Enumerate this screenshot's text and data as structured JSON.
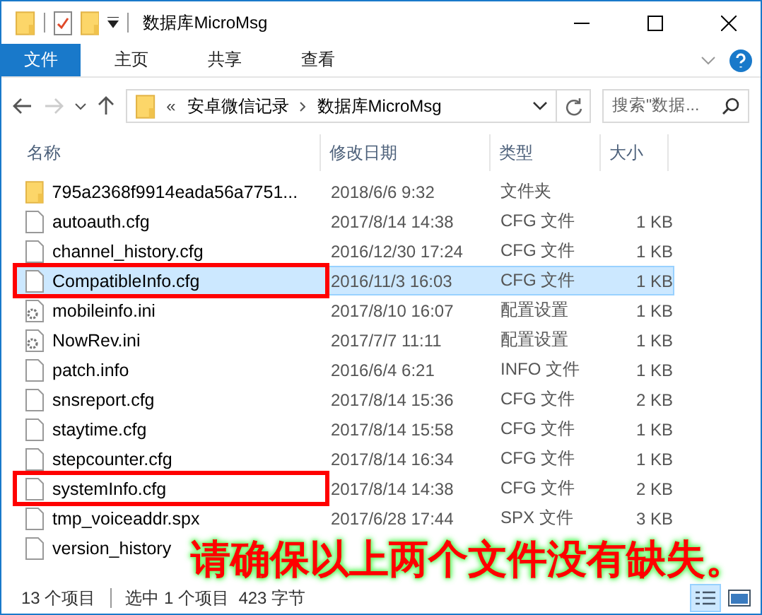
{
  "window": {
    "title": "数据库MicroMsg"
  },
  "ribbon_tabs": [
    {
      "label": "文件",
      "selected": true
    },
    {
      "label": "主页",
      "selected": false
    },
    {
      "label": "共享",
      "selected": false
    },
    {
      "label": "查看",
      "selected": false
    }
  ],
  "address": {
    "overflow": "«",
    "crumbs": [
      "安卓微信记录",
      "数据库MicroMsg"
    ]
  },
  "search": {
    "placeholder": "搜索\"数据..."
  },
  "columns": [
    "名称",
    "修改日期",
    "类型",
    "大小"
  ],
  "rows": [
    {
      "kind": "folder",
      "name": "795a2368f9914eada56a7751...",
      "date": "2018/6/6 9:32",
      "type": "文件夹",
      "selected": false,
      "marked": false
    },
    {
      "kind": "file",
      "name": "autoauth.cfg",
      "date": "2017/8/14 14:38",
      "type": "CFG 文件",
      "size": "1 KB",
      "selected": false,
      "marked": false
    },
    {
      "kind": "file",
      "name": "channel_history.cfg",
      "date": "2016/12/30 17:24",
      "type": "CFG 文件",
      "size": "1 KB",
      "selected": false,
      "marked": false
    },
    {
      "kind": "file",
      "name": "CompatibleInfo.cfg",
      "date": "2016/11/3 16:03",
      "type": "CFG 文件",
      "size": "1 KB",
      "selected": true,
      "marked": true
    },
    {
      "kind": "settings",
      "name": "mobileinfo.ini",
      "date": "2017/8/10 16:07",
      "type": "配置设置",
      "size": "1 KB",
      "selected": false,
      "marked": false
    },
    {
      "kind": "settings",
      "name": "NowRev.ini",
      "date": "2017/7/7 11:11",
      "type": "配置设置",
      "size": "1 KB",
      "selected": false,
      "marked": false
    },
    {
      "kind": "file",
      "name": "patch.info",
      "date": "2016/6/4 6:21",
      "type": "INFO 文件",
      "size": "1 KB",
      "selected": false,
      "marked": false
    },
    {
      "kind": "file",
      "name": "snsreport.cfg",
      "date": "2017/8/14 15:36",
      "type": "CFG 文件",
      "size": "2 KB",
      "selected": false,
      "marked": false
    },
    {
      "kind": "file",
      "name": "staytime.cfg",
      "date": "2017/8/14 15:58",
      "type": "CFG 文件",
      "size": "1 KB",
      "selected": false,
      "marked": false
    },
    {
      "kind": "file",
      "name": "stepcounter.cfg",
      "date": "2017/8/14 16:34",
      "type": "CFG 文件",
      "size": "1 KB",
      "selected": false,
      "marked": false
    },
    {
      "kind": "file",
      "name": "systemInfo.cfg",
      "date": "2017/8/14 14:38",
      "type": "CFG 文件",
      "size": "2 KB",
      "selected": false,
      "marked": true
    },
    {
      "kind": "file",
      "name": "tmp_voiceaddr.spx",
      "date": "2017/6/28 17:44",
      "type": "SPX 文件",
      "size": "3 KB",
      "selected": false,
      "marked": false
    },
    {
      "kind": "file",
      "name": "version_history",
      "selected": false,
      "marked": false
    }
  ],
  "status_bar": {
    "count": "13 个项目",
    "selection": "选中 1 个项目  423 字节",
    "views": [
      {
        "kind": "details",
        "selected": true
      },
      {
        "kind": "thumbnails",
        "selected": false
      }
    ]
  },
  "annotation": "请确保以上两个文件没有缺失。"
}
